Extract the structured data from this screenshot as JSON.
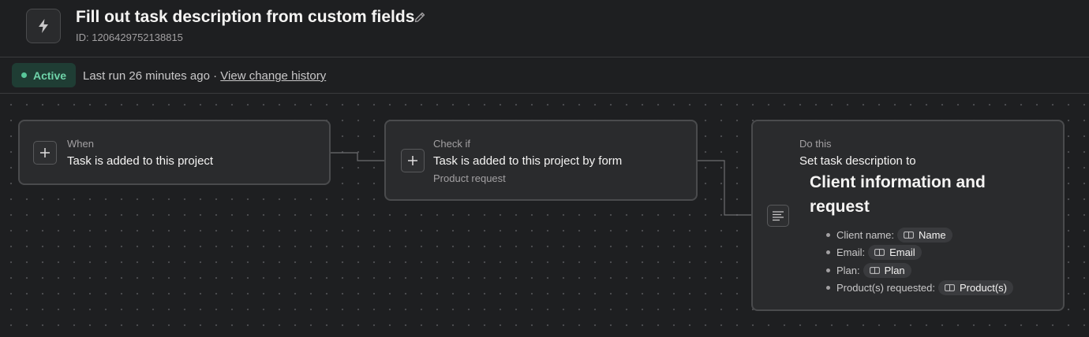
{
  "header": {
    "title": "Fill out task description from custom fields",
    "rule_id": "ID: 1206429752138815",
    "rule_icon": "lightning-icon",
    "edit_icon": "pencil-icon"
  },
  "status": {
    "badge": "Active",
    "last_run": "Last run 26 minutes ago ·",
    "history_link": "View change history",
    "accent": "#6fd3a9"
  },
  "trigger": {
    "kind": "When",
    "text": "Task is added to this project"
  },
  "condition": {
    "kind": "Check if",
    "text": "Task is added to this project by form",
    "sub": "Product request"
  },
  "action": {
    "kind": "Do this",
    "text": "Set task description to",
    "heading": "Client information and request",
    "fields": [
      {
        "label": "Client name:",
        "chip": "Name"
      },
      {
        "label": "Email:",
        "chip": "Email"
      },
      {
        "label": "Plan:",
        "chip": "Plan"
      },
      {
        "label": "Product(s) requested:",
        "chip": "Product(s)"
      }
    ]
  }
}
